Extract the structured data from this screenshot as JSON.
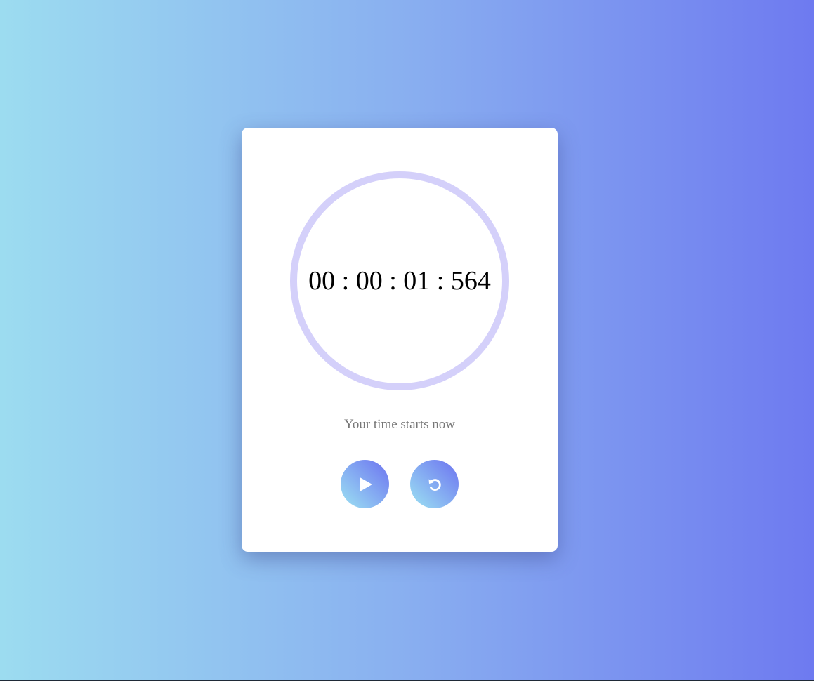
{
  "stopwatch": {
    "time_display": "00 : 00 : 01 : 564",
    "caption": "Your time starts now",
    "buttons": [
      {
        "name": "play",
        "icon": "play-icon"
      },
      {
        "name": "reset",
        "icon": "reset-icon"
      }
    ]
  },
  "colors": {
    "background_start": "#9cdcf0",
    "background_end": "#6e7af0",
    "ring": "#d4d0fa",
    "card": "#ffffff",
    "caption": "#777777"
  }
}
